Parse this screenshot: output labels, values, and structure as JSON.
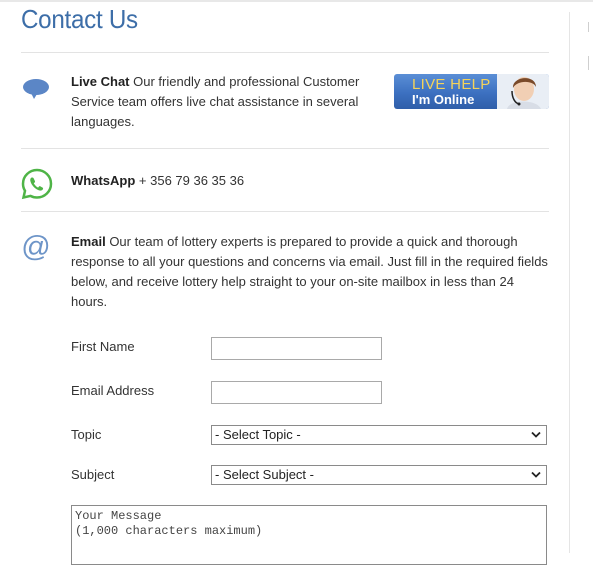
{
  "page": {
    "title": "Contact Us"
  },
  "live_chat": {
    "heading": "Live Chat",
    "text_line1": "Our friendly and professional Customer",
    "text_line2": "Service team offers live chat assistance in several",
    "text_line3": "languages.",
    "banner": {
      "line1": "LIVE HELP",
      "line2": "I'm Online"
    }
  },
  "whatsapp": {
    "heading": "WhatsApp",
    "number": "+ 356 79 36 35 36"
  },
  "email": {
    "heading": "Email",
    "line1": "Our team of lottery experts is prepared to provide a quick and thorough",
    "line2": "response to all your questions and concerns via email. Just fill in the required fields",
    "line3": "below, and receive lottery help straight to your on-site mailbox in less than 24",
    "line4": "hours."
  },
  "form": {
    "first_name_label": "First Name",
    "first_name_value": "",
    "email_label": "Email Address",
    "email_value": "",
    "topic_label": "Topic",
    "topic_selected": "- Select Topic -",
    "subject_label": "Subject",
    "subject_selected": "- Select Subject -",
    "message_placeholder": "Your Message\n(1,000 characters maximum)"
  },
  "icons": {
    "live_chat": "chat-bubble-icon",
    "whatsapp": "whatsapp-icon",
    "email": "at-sign-icon",
    "select": "chevron-down-icon"
  },
  "colors": {
    "title": "#3d6ea8",
    "chat_icon": "#5b86c6",
    "whatsapp_icon": "#4fb447",
    "at_icon": "#6e95c8",
    "banner_blue": "#3c70c0",
    "banner_yellow": "#f4d35a"
  }
}
